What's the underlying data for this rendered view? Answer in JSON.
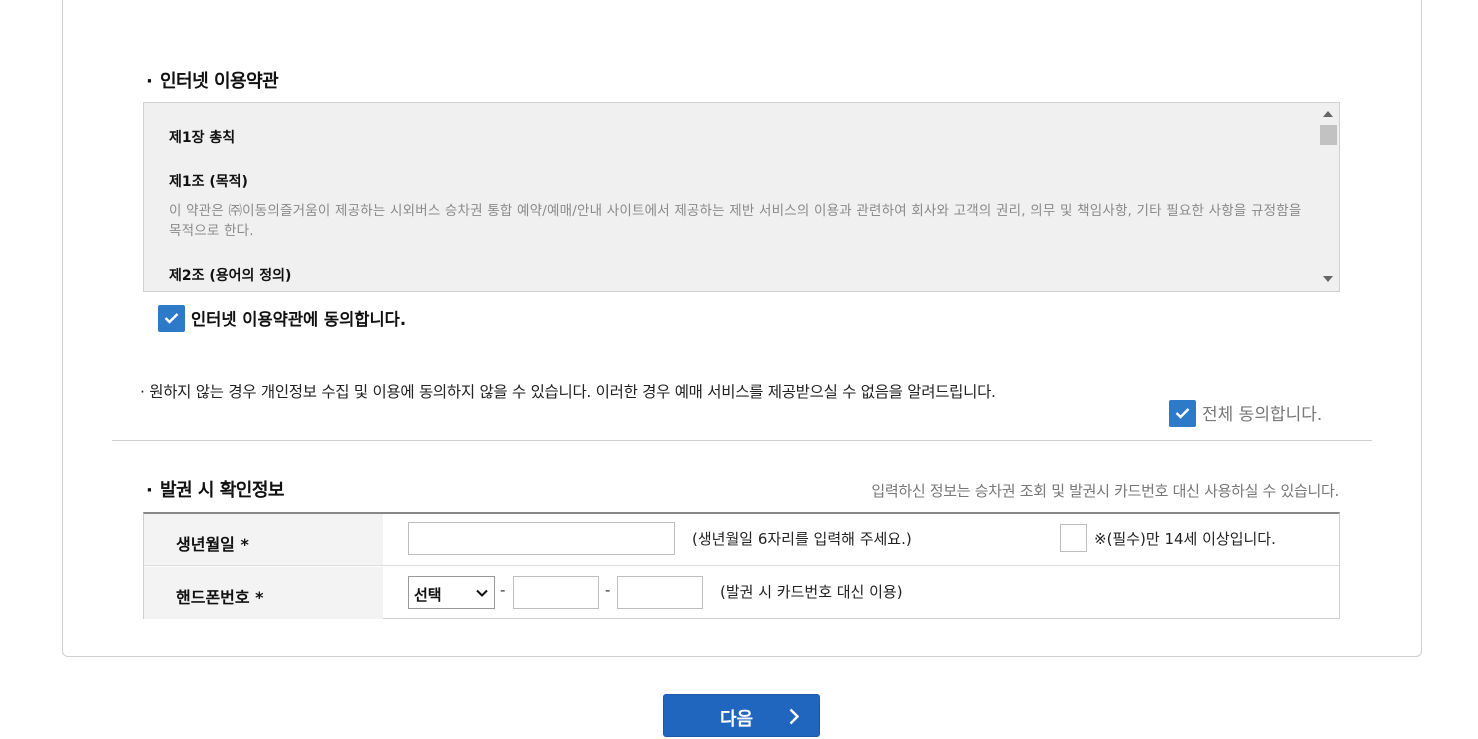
{
  "terms_section": {
    "title": "인터넷 이용약관",
    "chapter": "제1장 총칙",
    "article1_title": "제1조 (목적)",
    "article1_body": "이 약관은 ㈜이동의즐거움이 제공하는 시외버스 승차권 통합 예약/예매/안내 사이트에서 제공하는 제반 서비스의 이용과 관련하여 회사와 고객의 권리, 의무 및 책임사항, 기타 필요한 사항을 규정함을 목적으로 한다.",
    "article2_title": "제2조 (용어의 정의)",
    "agree_label": "인터넷 이용약관에 동의합니다.",
    "agree_checked": true
  },
  "notice": "원하지 않는 경우 개인정보 수집 및 이용에 동의하지 않을 수 있습니다. 이러한 경우 예매 서비스를 제공받으실 수 없음을 알려드립니다.",
  "agree_all": {
    "label": "전체 동의합니다.",
    "checked": true
  },
  "ticket_info": {
    "title": "발권 시 확인정보",
    "note": "입력하신 정보는 승차권 조회 및 발권시 카드번호 대신 사용하실 수 있습니다.",
    "birth": {
      "label": "생년월일 *",
      "value": "",
      "hint": "(생년월일 6자리를 입력해 주세요.)",
      "age_check_label": "※(필수)만 14세 이상입니다.",
      "age_checked": false
    },
    "phone": {
      "label": "핸드폰번호 *",
      "prefix_selected": "선택",
      "separator": "-",
      "middle": "",
      "last": "",
      "hint": "(발권 시 카드번호 대신 이용)"
    }
  },
  "next_button": {
    "label": "다음"
  },
  "colors": {
    "accent": "#2066be",
    "check": "#2d7ac9"
  }
}
